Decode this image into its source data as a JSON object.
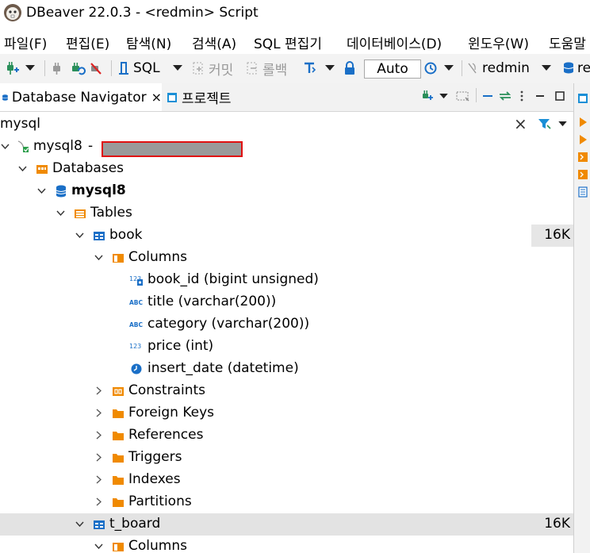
{
  "window": {
    "title": "DBeaver 22.0.3 - <redmin> Script"
  },
  "menubar": [
    "파일(F)",
    "편집(E)",
    "탐색(N)",
    "검색(A)",
    "SQL 편집기",
    "데이터베이스(D)",
    "윈도우(W)",
    "도움말"
  ],
  "toolbar": {
    "sql_label": "SQL",
    "commit_label": "커밋",
    "rollback_label": "롤백",
    "auto_commit_value": "Auto",
    "datasource_label": "redmin",
    "schema_label": "re"
  },
  "tabs": [
    {
      "label": "Database Navigator",
      "active": true,
      "close": "×"
    },
    {
      "label": "프로젝트",
      "active": false
    }
  ],
  "filter": {
    "value": "mysql",
    "clear": "×"
  },
  "tree": {
    "connection": {
      "label": "mysql8",
      "sep": "-"
    },
    "databases": "Databases",
    "database": "mysql8",
    "tables": "Tables",
    "book": {
      "label": "book",
      "size": "16K",
      "columns_label": "Columns",
      "columns": [
        {
          "label": "book_id (bigint unsigned)",
          "icon": "123"
        },
        {
          "label": "title (varchar(200))",
          "icon": "ABC"
        },
        {
          "label": "category (varchar(200))",
          "icon": "ABC"
        },
        {
          "label": "price (int)",
          "icon": "123"
        },
        {
          "label": "insert_date (datetime)",
          "icon": "clock"
        }
      ],
      "folders": [
        "Constraints",
        "Foreign Keys",
        "References",
        "Triggers",
        "Indexes",
        "Partitions"
      ]
    },
    "t_board": {
      "label": "t_board",
      "size": "16K",
      "columns_label": "Columns"
    }
  }
}
